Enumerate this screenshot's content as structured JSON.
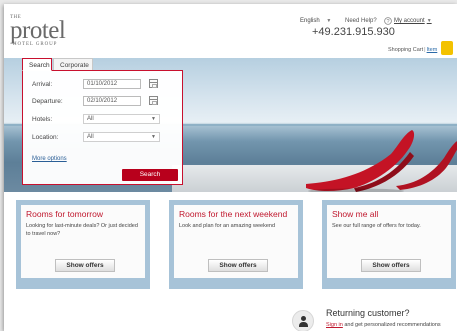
{
  "header": {
    "logo": {
      "the": "THE",
      "name": "protel",
      "group": "HOTEL GROUP"
    },
    "language": "English",
    "help_label": "Need Help?",
    "phone": "+49.231.915.930",
    "account_label": "My account",
    "cart_label": "Shopping Cart",
    "cart_separator": "|",
    "cart_items": "Item"
  },
  "search": {
    "tabs": [
      {
        "label": "Search",
        "active": true
      },
      {
        "label": "Corporate",
        "active": false
      }
    ],
    "arrival": {
      "label": "Arrival:",
      "value": "01/10/2012"
    },
    "departure": {
      "label": "Departure:",
      "value": "02/10/2012"
    },
    "hotels": {
      "label": "Hotels:",
      "value": "All"
    },
    "location": {
      "label": "Location:",
      "value": "All"
    },
    "more_options": "More options",
    "submit_label": "Search"
  },
  "offers": [
    {
      "title": "Rooms for tomorrow",
      "text": "Looking for last-minute deals? Or just decided to travel now?",
      "button": "Show offers"
    },
    {
      "title": "Rooms for the next weekend",
      "text": "Look and plan for an amazing weekend",
      "button": "Show offers"
    },
    {
      "title": "Show me all",
      "text": "See our full range of offers for today.",
      "button": "Show offers"
    }
  ],
  "returning": {
    "title": "Returning customer?",
    "link": "Sign in",
    "text": " and get personalized recommendations"
  },
  "colors": {
    "accent": "#c0182e",
    "search_button": "#b8001c",
    "offer_frame": "#a7c3d8",
    "cart_icon": "#f3c200"
  },
  "icons": {
    "language_dropdown": "chevron-down-icon",
    "help": "question-icon",
    "calendar": "calendar-icon",
    "select_dropdown": "chevron-down-icon",
    "cart": "cart-icon",
    "user": "user-icon"
  }
}
